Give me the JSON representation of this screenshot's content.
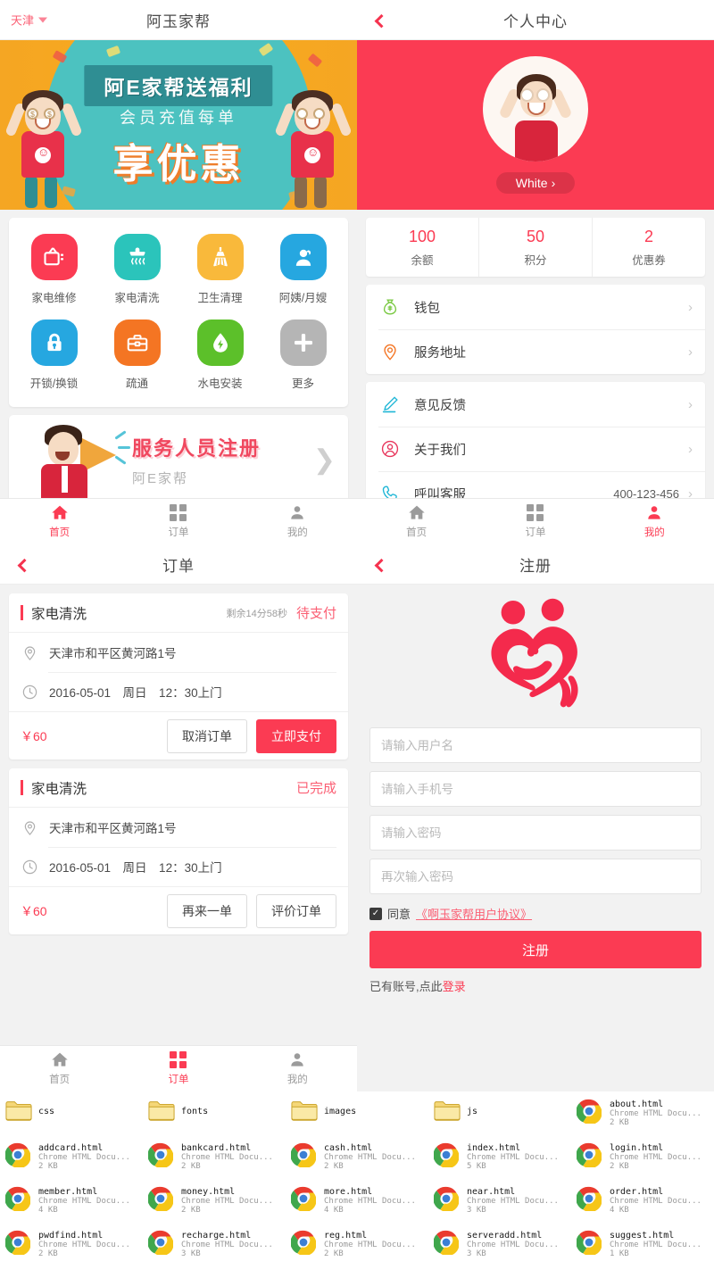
{
  "home": {
    "city": "天津",
    "title": "阿玉家帮",
    "promo": {
      "ribbon": "阿E家帮送福利",
      "sub": "会员充值每单",
      "main": "享优惠"
    },
    "services": [
      {
        "label": "家电维修",
        "icon": "tv-icon",
        "color": "#fb3b53"
      },
      {
        "label": "家电清洗",
        "icon": "washer-icon",
        "color": "#2bc4bb"
      },
      {
        "label": "卫生清理",
        "icon": "broom-icon",
        "color": "#f9b93b"
      },
      {
        "label": "阿姨/月嫂",
        "icon": "nanny-icon",
        "color": "#26a7e0"
      },
      {
        "label": "开锁/换锁",
        "icon": "lock-icon",
        "color": "#26a7e0"
      },
      {
        "label": "疏通",
        "icon": "toolbox-icon",
        "color": "#f47523"
      },
      {
        "label": "水电安装",
        "icon": "waterdrop-icon",
        "color": "#5cc02a"
      },
      {
        "label": "更多",
        "icon": "plus-icon",
        "color": "#b5b5b5"
      }
    ],
    "register_banner": {
      "title": "服务人员注册",
      "subtitle": "阿E家帮"
    }
  },
  "tabbar": {
    "home": "首页",
    "order": "订单",
    "mine": "我的"
  },
  "profile": {
    "title": "个人中心",
    "username": "White",
    "stats": [
      {
        "num": "100",
        "label": "余额"
      },
      {
        "num": "50",
        "label": "积分"
      },
      {
        "num": "2",
        "label": "优惠券"
      }
    ],
    "group1": [
      {
        "label": "钱包",
        "icon": "moneybag-icon",
        "color": "#7ac943",
        "value": ""
      },
      {
        "label": "服务地址",
        "icon": "location-pin-icon",
        "color": "#f47523",
        "value": ""
      }
    ],
    "group2": [
      {
        "label": "意见反馈",
        "icon": "pencil-icon",
        "color": "#1fb6d6",
        "value": ""
      },
      {
        "label": "关于我们",
        "icon": "user-circle-icon",
        "color": "#e8365c",
        "value": ""
      },
      {
        "label": "呼叫客服",
        "icon": "phone-icon",
        "color": "#1fb6d6",
        "value": "400-123-456"
      }
    ]
  },
  "order": {
    "title": "订单",
    "cards": [
      {
        "service": "家电清洗",
        "countdown": "剩余14分58秒",
        "status": "待支付",
        "address": "天津市和平区黄河路1号",
        "time": "2016-05-01　周日　12：30上门",
        "price": "￥60",
        "buttons": [
          {
            "label": "取消订单",
            "primary": false
          },
          {
            "label": "立即支付",
            "primary": true
          }
        ]
      },
      {
        "service": "家电清洗",
        "countdown": "",
        "status": "已完成",
        "address": "天津市和平区黄河路1号",
        "time": "2016-05-01　周日　12：30上门",
        "price": "￥60",
        "buttons": [
          {
            "label": "再来一单",
            "primary": false
          },
          {
            "label": "评价订单",
            "primary": false
          }
        ]
      }
    ]
  },
  "register": {
    "title": "注册",
    "fields": [
      {
        "placeholder": "请输入用户名",
        "value": ""
      },
      {
        "placeholder": "请输入手机号",
        "value": ""
      },
      {
        "placeholder": "请输入密码",
        "value": ""
      },
      {
        "placeholder": "再次输入密码",
        "value": ""
      }
    ],
    "agree_text": "同意",
    "agree_link": "《啊玉家帮用户协议》",
    "submit": "注册",
    "has_account_prefix": "已有账号,点此",
    "has_account_link": "登录"
  },
  "explorer": {
    "items": [
      {
        "name": "css",
        "type": "",
        "size": "",
        "kind": "folder"
      },
      {
        "name": "fonts",
        "type": "",
        "size": "",
        "kind": "folder"
      },
      {
        "name": "images",
        "type": "",
        "size": "",
        "kind": "folder"
      },
      {
        "name": "js",
        "type": "",
        "size": "",
        "kind": "folder"
      },
      {
        "name": "about.html",
        "type": "Chrome HTML Docu...",
        "size": "2 KB",
        "kind": "chrome"
      },
      {
        "name": "addcard.html",
        "type": "Chrome HTML Docu...",
        "size": "2 KB",
        "kind": "chrome"
      },
      {
        "name": "bankcard.html",
        "type": "Chrome HTML Docu...",
        "size": "2 KB",
        "kind": "chrome"
      },
      {
        "name": "cash.html",
        "type": "Chrome HTML Docu...",
        "size": "2 KB",
        "kind": "chrome"
      },
      {
        "name": "index.html",
        "type": "Chrome HTML Docu...",
        "size": "5 KB",
        "kind": "chrome"
      },
      {
        "name": "login.html",
        "type": "Chrome HTML Docu...",
        "size": "2 KB",
        "kind": "chrome"
      },
      {
        "name": "member.html",
        "type": "Chrome HTML Docu...",
        "size": "4 KB",
        "kind": "chrome"
      },
      {
        "name": "money.html",
        "type": "Chrome HTML Docu...",
        "size": "2 KB",
        "kind": "chrome"
      },
      {
        "name": "more.html",
        "type": "Chrome HTML Docu...",
        "size": "4 KB",
        "kind": "chrome"
      },
      {
        "name": "near.html",
        "type": "Chrome HTML Docu...",
        "size": "3 KB",
        "kind": "chrome"
      },
      {
        "name": "order.html",
        "type": "Chrome HTML Docu...",
        "size": "4 KB",
        "kind": "chrome"
      },
      {
        "name": "pwdfind.html",
        "type": "Chrome HTML Docu...",
        "size": "2 KB",
        "kind": "chrome"
      },
      {
        "name": "recharge.html",
        "type": "Chrome HTML Docu...",
        "size": "3 KB",
        "kind": "chrome"
      },
      {
        "name": "reg.html",
        "type": "Chrome HTML Docu...",
        "size": "2 KB",
        "kind": "chrome"
      },
      {
        "name": "serveradd.html",
        "type": "Chrome HTML Docu...",
        "size": "3 KB",
        "kind": "chrome"
      },
      {
        "name": "suggest.html",
        "type": "Chrome HTML Docu...",
        "size": "1 KB",
        "kind": "chrome"
      }
    ]
  },
  "colors": {
    "accent": "#fb3b53",
    "banner_orange": "#f7a91e",
    "banner_teal": "#4cc2c0"
  }
}
